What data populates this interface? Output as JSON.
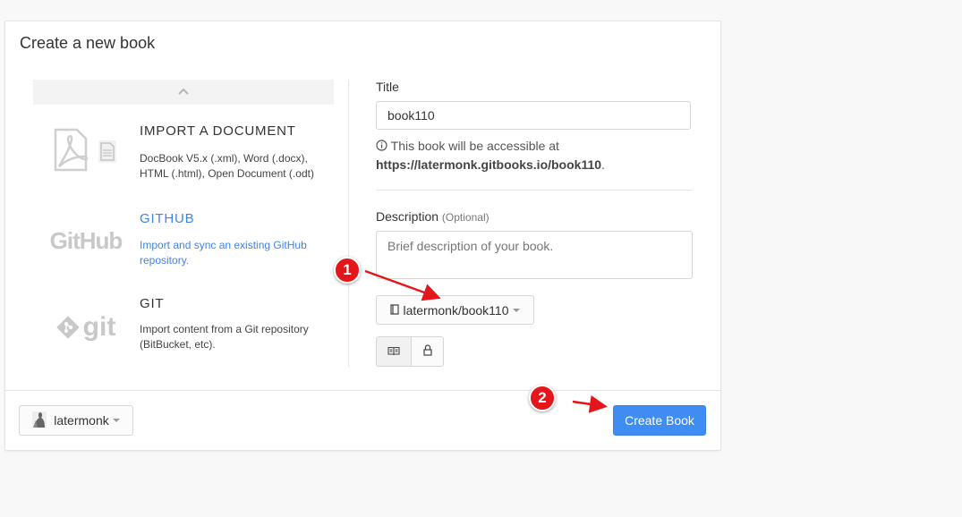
{
  "dialog": {
    "title": "Create a new book"
  },
  "sources": [
    {
      "title": "IMPORT A DOCUMENT",
      "description": "DocBook V5.x (.xml), Word (.docx), HTML (.html), Open Document (.odt)",
      "icon": "pdf-document-icon"
    },
    {
      "title": "GITHUB",
      "description": "Import and sync an existing GitHub repository.",
      "logo_text": "GitHub",
      "color": "#4183e8"
    },
    {
      "title": "GIT",
      "description": "Import content from a Git repository (BitBucket, etc).",
      "logo_text": "git"
    }
  ],
  "form": {
    "title_label": "Title",
    "title_value": "book110",
    "help_text": "This book will be accessible at",
    "help_url": "https://latermonk.gitbooks.io/book110",
    "help_suffix": ".",
    "description_label": "Description",
    "description_optional": "(Optional)",
    "description_placeholder": "Brief description of your book.",
    "repo_select": "latermonk/book110",
    "visibility_icons": [
      "book-icon",
      "lock-icon"
    ]
  },
  "footer": {
    "owner": "latermonk",
    "create_button": "Create Book"
  },
  "annotations": {
    "badge1": "1",
    "badge2": "2",
    "badge_color": "#e4161b"
  }
}
